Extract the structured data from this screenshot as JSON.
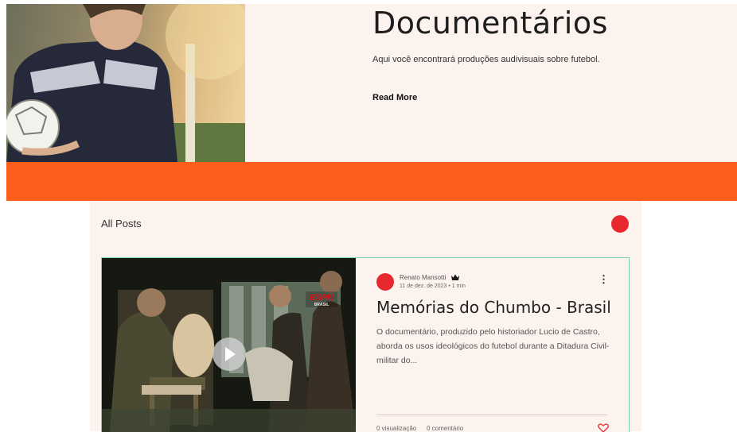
{
  "hero": {
    "title": "Documentários",
    "description": "Aqui você encontrará produções audivisuais sobre futebol.",
    "read_more": "Read More"
  },
  "blog": {
    "nav_label": "All Posts"
  },
  "post": {
    "author": "Renato Mansotti",
    "date": "11 de dez. de 2023",
    "read_time": "1 min",
    "title": "Memórias do Chumbo - Brasil",
    "excerpt": "O documentário, produzido pelo historiador Lucio de Castro, aborda os usos ideológicos do futebol durante a Ditadura Civil-militar do...",
    "views": "0 visualização",
    "comments": "0 comentário",
    "video_badge": "ESPN BRASIL"
  },
  "colors": {
    "band": "#fd5e1b",
    "accent_red": "#e8282f",
    "card_border": "#7ed3a3",
    "panel_bg": "#fcf3ee"
  },
  "icons": {
    "more": "more-icon",
    "crown": "crown-icon",
    "heart": "heart-icon",
    "play": "play-icon"
  }
}
